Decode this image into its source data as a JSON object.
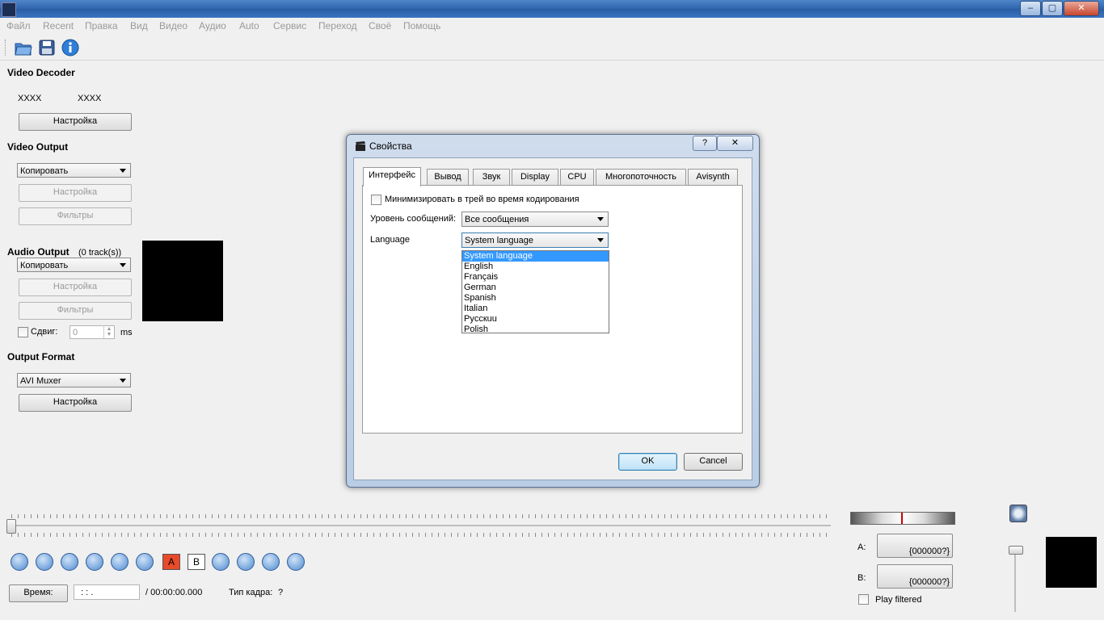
{
  "menu": [
    "Файл",
    "Recent",
    "Правка",
    "Вид",
    "Видео",
    "Аудио",
    "Auto",
    "Сервис",
    "Переход",
    "Своё",
    "Помощь"
  ],
  "window_controls": {
    "minimize": "–",
    "maximize": "▢",
    "close": "✕"
  },
  "left": {
    "video_decoder": {
      "title": "Video Decoder",
      "codec_a": "XXXX",
      "codec_b": "XXXX",
      "config": "Настройка"
    },
    "video_output": {
      "title": "Video Output",
      "mode": "Копировать",
      "config": "Настройка",
      "filters": "Фильтры"
    },
    "audio_output": {
      "title": "Audio Output",
      "tracks": "(0 track(s))",
      "mode": "Копировать",
      "config": "Настройка",
      "filters": "Фильтры",
      "shift_label": "Сдвиг:",
      "shift_value": "0",
      "shift_unit": "ms"
    },
    "output_format": {
      "title": "Output Format",
      "muxer": "AVI Muxer",
      "config": "Настройка"
    }
  },
  "dialog": {
    "title": "Свойства",
    "help": "?",
    "close": "✕",
    "tabs": [
      "Интерфейс",
      "Вывод",
      "Звук",
      "Display",
      "CPU",
      "Многопоточность",
      "Avisynth"
    ],
    "minimize_tray": "Минимизировать в трей во время кодирования",
    "msg_level_label": "Уровень сообщений:",
    "msg_level_value": "Все сообщения",
    "language_label": "Language",
    "language_value": "System language",
    "language_options": [
      "System language",
      "English",
      "Français",
      "German",
      "Spanish",
      "Italian",
      "Pyccкuu",
      "Polish"
    ],
    "ok": "OK",
    "cancel": "Cancel"
  },
  "bottom": {
    "time_button": "Время:",
    "time_value": ": : .",
    "duration": "/ 00:00:00.000",
    "frame_type_label": "Тип кадра:",
    "frame_type_value": "?",
    "marker_a_label": "A:",
    "marker_a_value": "{000000?}",
    "marker_b_label": "B:",
    "marker_b_value": "{000000?}",
    "play_filtered": "Play filtered",
    "a_marker": "A",
    "b_marker": "B"
  }
}
